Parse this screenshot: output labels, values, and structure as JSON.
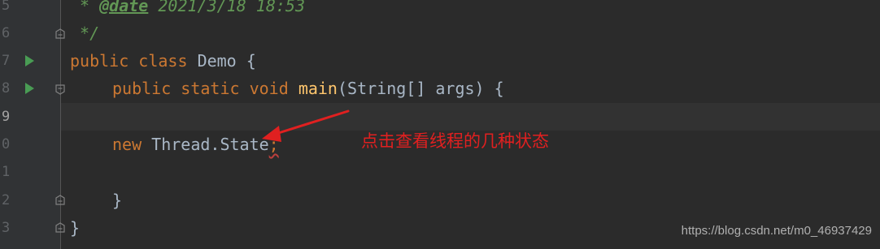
{
  "editor": {
    "line_numbers": [
      "5",
      "6",
      "7",
      "8",
      "9",
      "0",
      "1",
      "2",
      "3"
    ],
    "lines": {
      "l5": {
        "prefix": " * ",
        "tag": "@date",
        "rest": " 2021/3/18 18:53"
      },
      "l6": {
        "text": " */"
      },
      "l7": {
        "kw1": "public",
        "kw2": "class",
        "name": "Demo {"
      },
      "l8": {
        "kw1": "public",
        "kw2": "static",
        "kw3": "void",
        "method": "main",
        "params": "(String[] args) {"
      },
      "l10": {
        "kw": "new",
        "expr": "Thread.State",
        "semi": ";"
      },
      "l12": {
        "text": "}"
      },
      "l13": {
        "text": "}"
      }
    }
  },
  "annotation": {
    "text": "点击查看线程的几种状态",
    "color": "#e02020"
  },
  "watermark": "https://blog.csdn.net/m0_46937429",
  "colors": {
    "background": "#2b2b2b",
    "gutter": "#313335",
    "keyword": "#cc7832",
    "comment": "#629755",
    "method": "#ffc66d",
    "text": "#a9b7c6",
    "run_icon": "#499c54"
  }
}
